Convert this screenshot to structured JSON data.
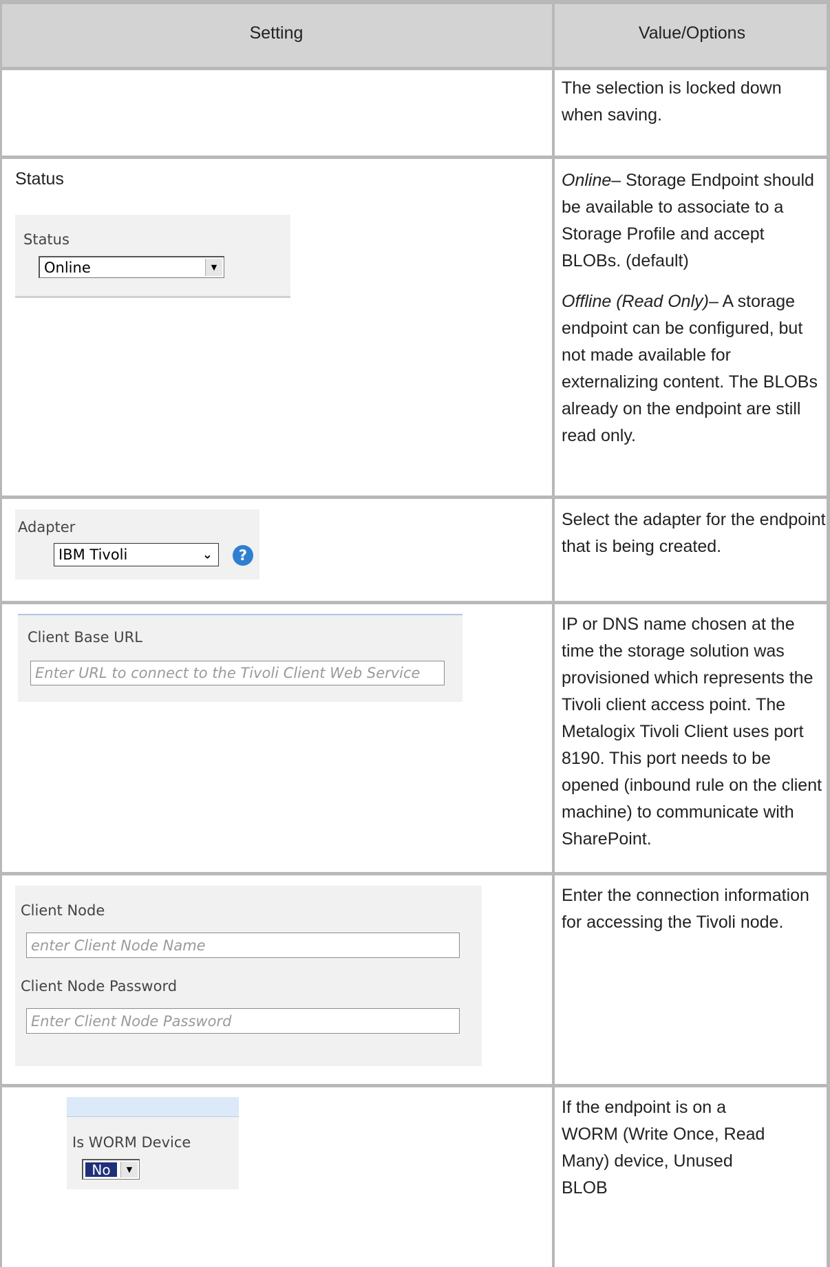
{
  "table": {
    "headers": {
      "setting": "Setting",
      "value": "Value/Options"
    },
    "rows": [
      {
        "value_text": [
          "The selection is locked down when saving."
        ]
      },
      {
        "setting_label": "Status",
        "form": {
          "label": "Status",
          "selected": "Online"
        },
        "value_items": [
          {
            "term": "Online",
            "text": "– Storage Endpoint should be available to associate to a Storage Profile and accept BLOBs. (default)"
          },
          {
            "term": "Offline (Read Only)",
            "text": "– A storage endpoint can be configured, but not made available for externalizing content. The BLOBs already on the endpoint are still read only."
          }
        ]
      },
      {
        "form": {
          "label": "Adapter",
          "selected": "IBM Tivoli",
          "help_icon": "help-icon"
        },
        "value_text": [
          "Select the adapter for the endpoint that is being created."
        ]
      },
      {
        "form": {
          "label": "Client Base URL",
          "placeholder": "Enter URL to connect to the Tivoli Client Web Service"
        },
        "value_text": [
          "IP or DNS name chosen at the time the storage solution was provisioned which represents the Tivoli client access point. The Metalogix Tivoli Client uses port 8190. This port needs to be opened (inbound rule on the client machine) to communicate with SharePoint."
        ]
      },
      {
        "form": {
          "node_label": "Client Node",
          "node_placeholder": "enter Client Node Name",
          "password_label": "Client Node Password",
          "password_placeholder": "Enter Client Node Password"
        },
        "value_text": [
          "Enter the connection information for accessing the Tivoli node."
        ]
      },
      {
        "form": {
          "label": "Is WORM Device",
          "selected": "No"
        },
        "value_text": [
          "If the endpoint is on a WORM (Write Once, Read Many) device, Unused BLOB"
        ]
      }
    ]
  },
  "colors": {
    "header_bg": "#d3d3d3",
    "grid": "#b8b8b8",
    "panel_bg": "#f1f1f1",
    "help_icon": "#2f7fd0",
    "selected_highlight": "#1f2f7a"
  }
}
